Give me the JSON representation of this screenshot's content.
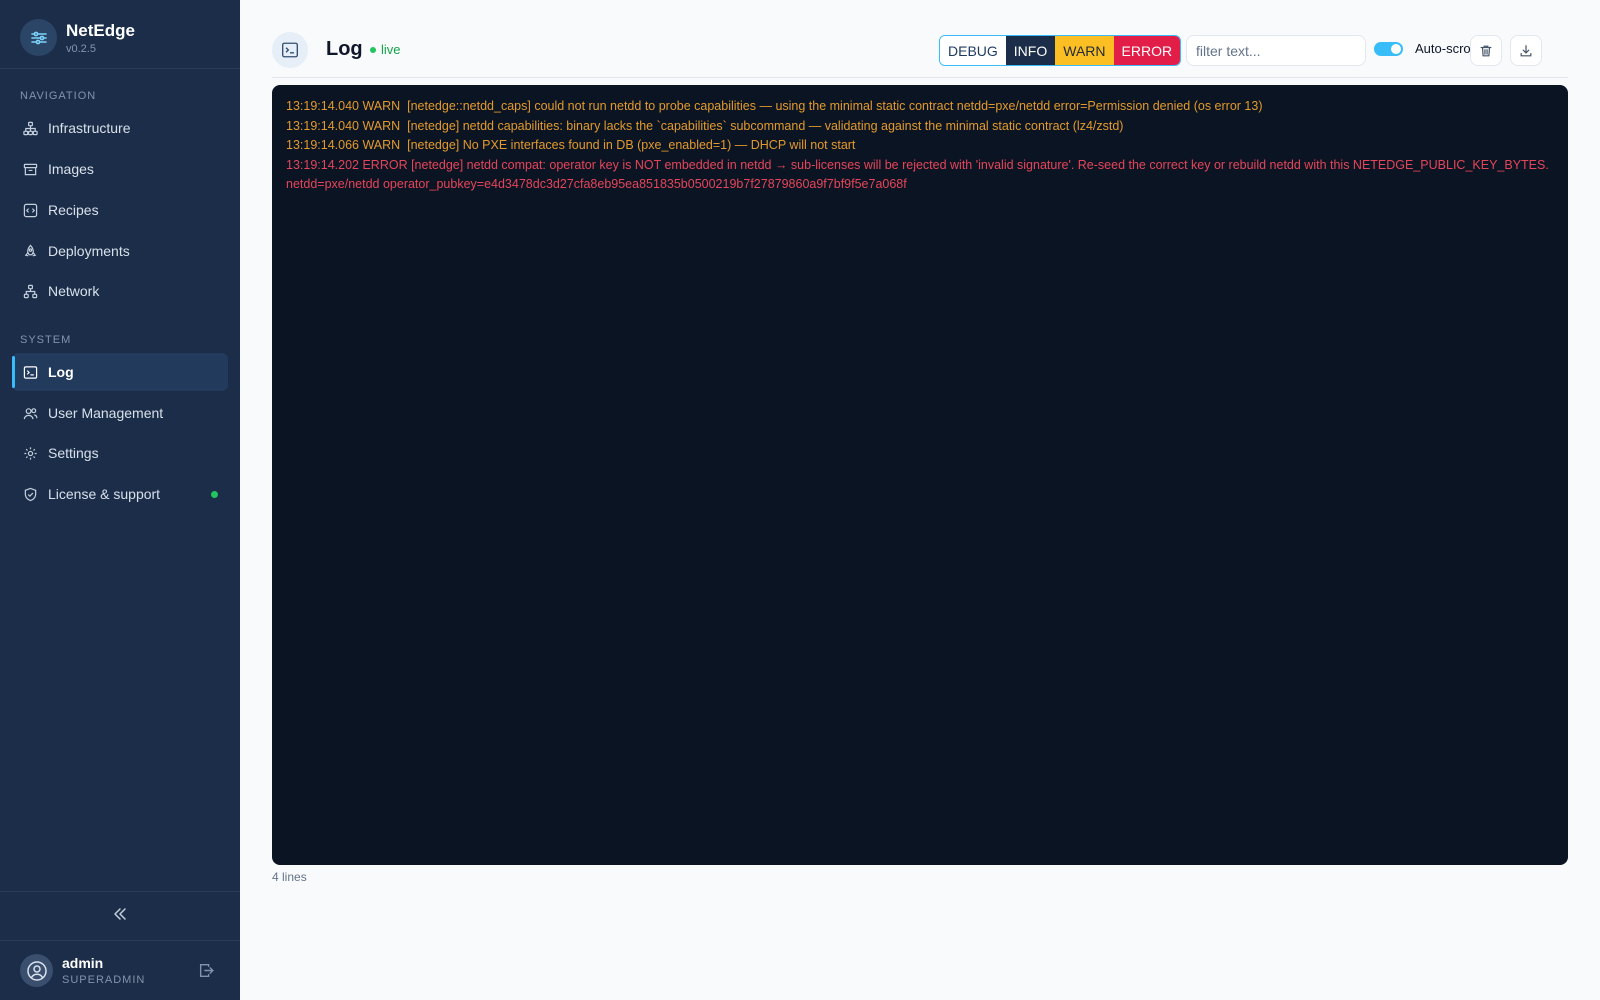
{
  "app": {
    "name": "NetEdge",
    "version": "v0.2.5"
  },
  "sidebar": {
    "navigation_label": "NAVIGATION",
    "navigation_items": [
      {
        "label": "Infrastructure",
        "icon": "sitemap-icon"
      },
      {
        "label": "Images",
        "icon": "archive-icon"
      },
      {
        "label": "Recipes",
        "icon": "recipe-icon"
      },
      {
        "label": "Deployments",
        "icon": "rocket-icon"
      },
      {
        "label": "Network",
        "icon": "network-icon"
      }
    ],
    "system_label": "SYSTEM",
    "system_items": [
      {
        "label": "Log",
        "icon": "terminal-icon",
        "active": true
      },
      {
        "label": "User Management",
        "icon": "users-icon"
      },
      {
        "label": "Settings",
        "icon": "gear-icon"
      },
      {
        "label": "License & support",
        "icon": "shield-icon",
        "status": "ok"
      }
    ],
    "user": {
      "name": "admin",
      "role": "SUPERADMIN"
    }
  },
  "header": {
    "title": "Log",
    "live_label": "live",
    "levels": [
      {
        "label": "DEBUG",
        "key": "debug"
      },
      {
        "label": "INFO",
        "key": "info",
        "selected": true
      },
      {
        "label": "WARN",
        "key": "warn"
      },
      {
        "label": "ERROR",
        "key": "error"
      }
    ],
    "filter_placeholder": "filter text...",
    "autoscroll_label": "Auto-scroll",
    "autoscroll_on": true
  },
  "log": {
    "lines": [
      {
        "level": "warn",
        "text": "13:19:14.040 WARN  [netedge::netdd_caps] could not run netdd to probe capabilities — using the minimal static contract netdd=pxe/netdd error=Permission denied (os error 13)"
      },
      {
        "level": "warn",
        "text": "13:19:14.040 WARN  [netedge] netdd capabilities: binary lacks the `capabilities` subcommand — validating against the minimal static contract (lz4/zstd)"
      },
      {
        "level": "warn",
        "text": "13:19:14.066 WARN  [netedge] No PXE interfaces found in DB (pxe_enabled=1) — DHCP will not start"
      },
      {
        "level": "error",
        "text": "13:19:14.202 ERROR [netedge] netdd compat: operator key is NOT embedded in netdd → sub-licenses will be rejected with 'invalid signature'. Re-seed the correct key or rebuild netdd with this NETEDGE_PUBLIC_KEY_BYTES. netdd=pxe/netdd operator_pubkey=e4d3478dc3d27cfa8eb95ea851835b0500219b7f27879860a9f7bf9f5e7a068f"
      }
    ],
    "count_label": "4 lines"
  },
  "colors": {
    "sidebar_bg": "#1b2d48",
    "accent": "#38bdf8",
    "warn": "#e39a2c",
    "error": "#e5455a",
    "live": "#22c55e"
  }
}
